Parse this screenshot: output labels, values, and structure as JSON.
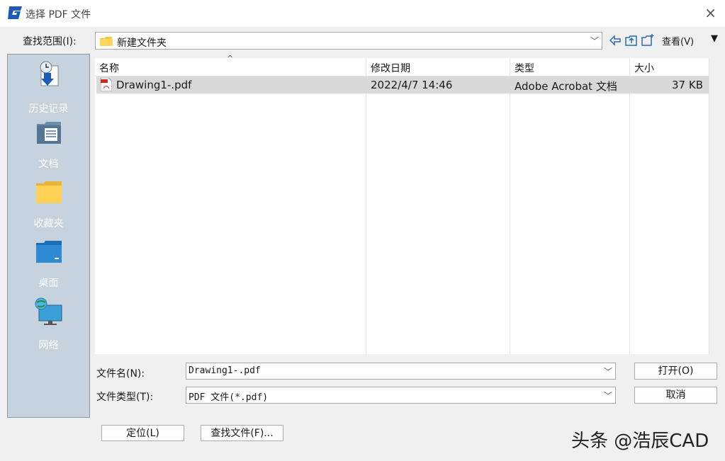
{
  "window": {
    "title": "选择 PDF 文件",
    "close_label": "×"
  },
  "toolbar": {
    "lookin_label": "查找范围(I):",
    "lookin_value": "新建文件夹",
    "view_label": "查看(V)",
    "view_arrow": "▼",
    "icons": [
      "back-icon",
      "up-folder-icon",
      "new-folder-icon"
    ]
  },
  "places": [
    {
      "label": "历史记录",
      "icon": "history-icon"
    },
    {
      "label": "文档",
      "icon": "documents-icon"
    },
    {
      "label": "收藏夹",
      "icon": "favorites-icon"
    },
    {
      "label": "桌面",
      "icon": "desktop-icon"
    },
    {
      "label": "网络",
      "icon": "network-icon"
    }
  ],
  "file_list": {
    "columns": [
      "名称",
      "修改日期",
      "类型",
      "大小"
    ],
    "rows": [
      {
        "name": "Drawing1-.pdf",
        "modified": "2022/4/7 14:46",
        "type": "Adobe Acrobat 文档",
        "size": "37 KB"
      }
    ]
  },
  "form": {
    "filename_label": "文件名(N):",
    "filename_value": "Drawing1-.pdf",
    "filetype_label": "文件类型(T):",
    "filetype_value": "PDF 文件(*.pdf)"
  },
  "buttons": {
    "open": "打开(O)",
    "cancel": "取消",
    "locate": "定位(L)",
    "find": "查找文件(F)..."
  },
  "watermark": "头条 @浩辰CAD",
  "colors": {
    "places_bg": "#c6d3de",
    "selected_row": "#d9d9d9",
    "app_icon_blue": "#1e5bb8"
  }
}
